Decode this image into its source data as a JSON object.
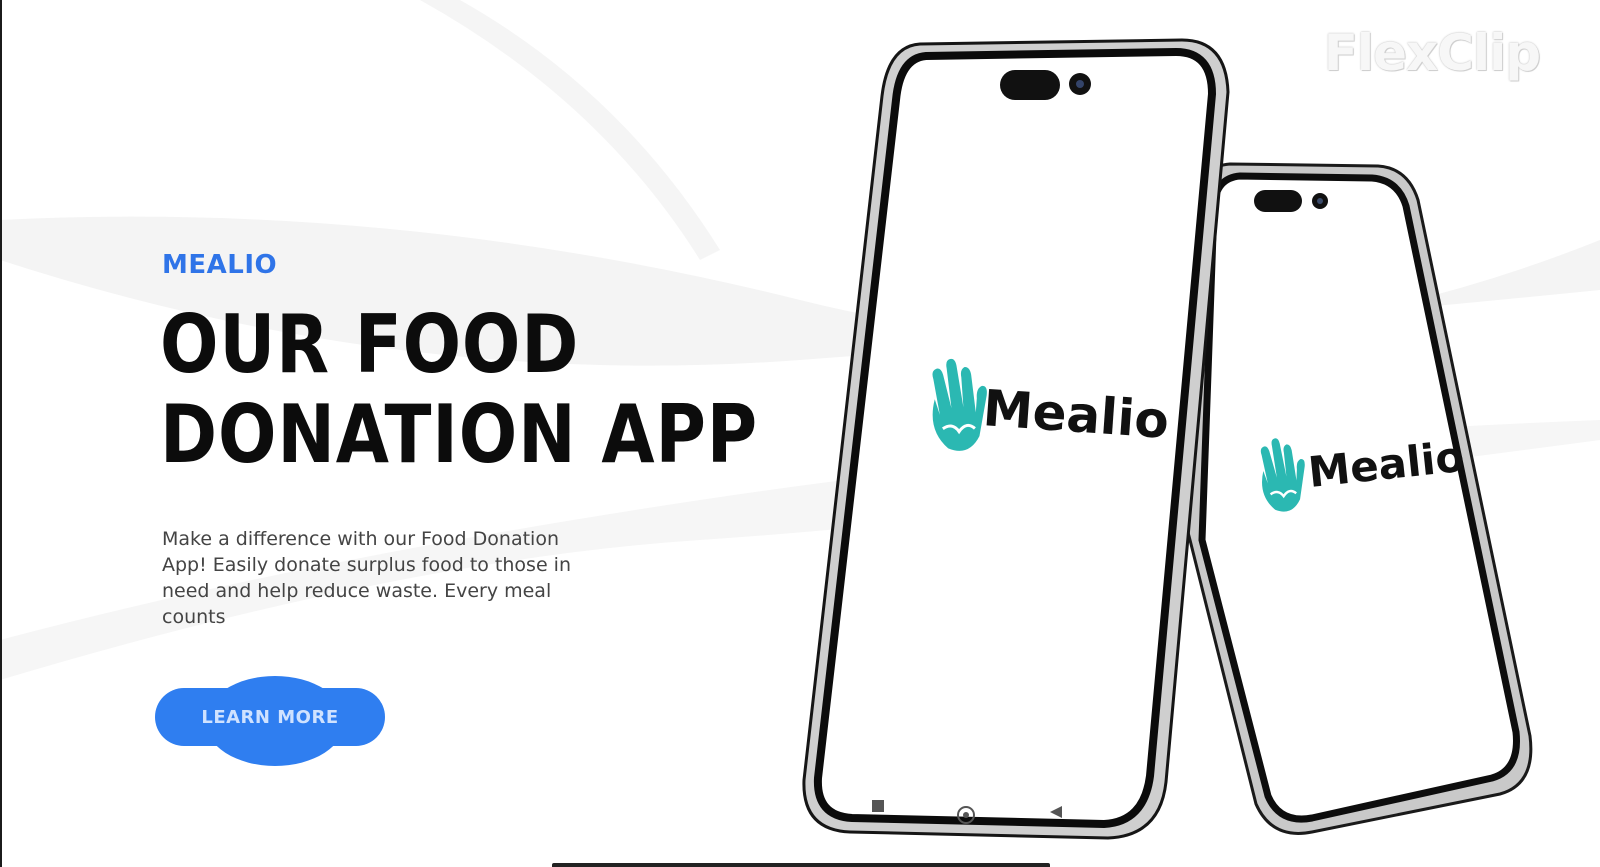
{
  "watermark": "FlexClip",
  "hero": {
    "brand": "MEALIO",
    "headline_line1": "OUR FOOD",
    "headline_line2": "DONATION APP",
    "description": "Make a difference with our Food Donation App! Easily donate surplus food to those in need and help reduce waste. Every meal counts",
    "cta_label": "LEARN MORE"
  },
  "phones": {
    "front_app_name": "Mealio",
    "back_app_name": "Mealio"
  },
  "colors": {
    "accent": "#2f74e8",
    "logo_teal": "#2bb8b2",
    "headline": "#0c0c0c"
  },
  "icons": [
    "hand-heart-icon",
    "camera-icon",
    "home-icon",
    "back-icon",
    "recent-apps-icon"
  ]
}
